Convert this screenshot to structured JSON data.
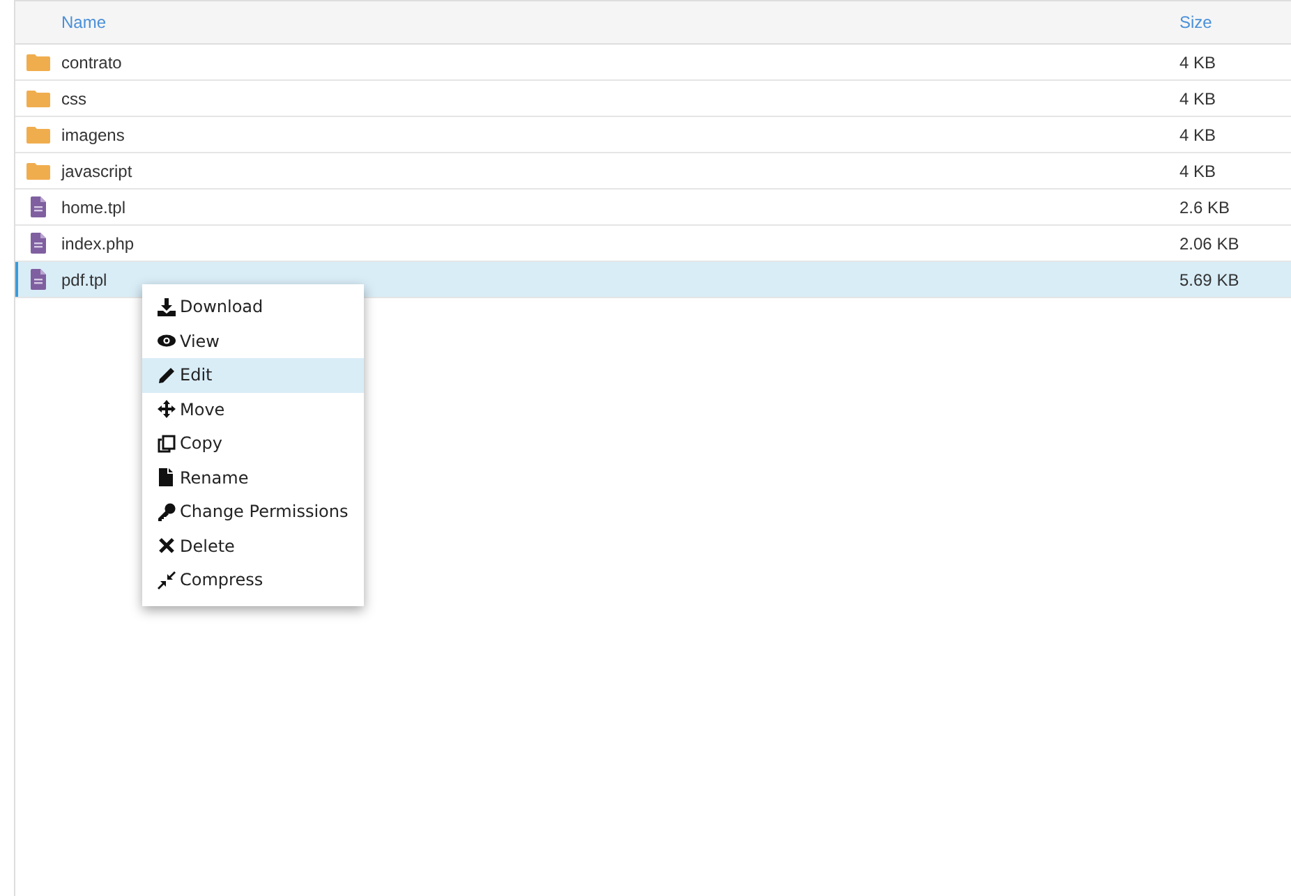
{
  "table": {
    "columns": [
      "Name",
      "Size"
    ],
    "rows": [
      {
        "kind": "folder",
        "name": "contrato",
        "size": "4 KB",
        "selected": false
      },
      {
        "kind": "folder",
        "name": "css",
        "size": "4 KB",
        "selected": false
      },
      {
        "kind": "folder",
        "name": "imagens",
        "size": "4 KB",
        "selected": false
      },
      {
        "kind": "folder",
        "name": "javascript",
        "size": "4 KB",
        "selected": false
      },
      {
        "kind": "file",
        "name": "home.tpl",
        "size": "2.6 KB",
        "selected": false
      },
      {
        "kind": "file",
        "name": "index.php",
        "size": "2.06 KB",
        "selected": false
      },
      {
        "kind": "file",
        "name": "pdf.tpl",
        "size": "5.69 KB",
        "selected": true
      }
    ]
  },
  "context_menu": {
    "items": [
      {
        "label": "Download",
        "selected": false
      },
      {
        "label": "View",
        "selected": false
      },
      {
        "label": "Edit",
        "selected": true
      },
      {
        "label": "Move",
        "selected": false
      },
      {
        "label": "Copy",
        "selected": false
      },
      {
        "label": "Rename",
        "selected": false
      },
      {
        "label": "Change Permissions",
        "selected": false
      },
      {
        "label": "Delete",
        "selected": false
      },
      {
        "label": "Compress",
        "selected": false
      }
    ]
  }
}
